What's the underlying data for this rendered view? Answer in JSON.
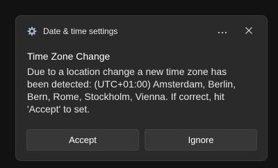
{
  "notification": {
    "app_name": "Date & time settings",
    "app_icon": "gear-icon",
    "title": "Time Zone Change",
    "message": "Due to a location change a new time zone has been detected: (UTC+01:00) Amsterdam, Berlin, Bern, Rome, Stockholm, Vienna. If correct, hit 'Accept' to set.",
    "more_icon": "more-options-icon",
    "close_icon": "close-icon"
  },
  "actions": {
    "accept_label": "Accept",
    "ignore_label": "Ignore"
  },
  "colors": {
    "background": "#121212",
    "toast_background": "#2a2a2a",
    "button_background": "#373737",
    "text": "#ffffff"
  }
}
